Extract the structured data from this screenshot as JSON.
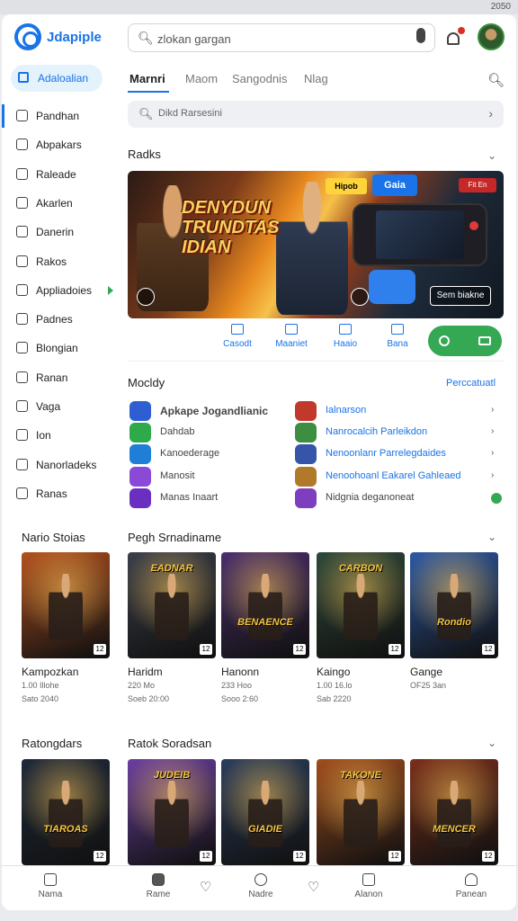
{
  "status": {
    "right": "2050"
  },
  "header": {
    "brand": "Jdapiple",
    "search_placeholder": "zlokan gargan",
    "accent": "#1a73e8"
  },
  "sidebar": {
    "active": "Adaloalian",
    "items": [
      {
        "label": "Pandhan",
        "icon": "home-icon"
      },
      {
        "label": "Abpakars",
        "icon": "list-icon"
      },
      {
        "label": "Raleade",
        "icon": "grid-icon"
      },
      {
        "label": "Akarlen",
        "icon": "file-icon"
      },
      {
        "label": "Danerin",
        "icon": "tag-icon"
      },
      {
        "label": "Rakos",
        "icon": "book-icon"
      },
      {
        "label": "Appliadoies",
        "icon": "user-icon"
      },
      {
        "label": "Padnes",
        "icon": "smile-icon"
      },
      {
        "label": "Blongian",
        "icon": "doc-icon"
      },
      {
        "label": "Ranan",
        "icon": "box-icon"
      },
      {
        "label": "Vaga",
        "icon": "clock-icon"
      },
      {
        "label": "Ion",
        "icon": "calendar-icon"
      },
      {
        "label": "Nanorladeks",
        "icon": "tiles-icon"
      },
      {
        "label": "Ranas",
        "icon": "star-icon"
      }
    ]
  },
  "tabs": [
    "Marnri",
    "Maom",
    "Sangodnis",
    "Nlag"
  ],
  "filter": {
    "text": "Dikd Rarsesini"
  },
  "packs": {
    "title": "Radks"
  },
  "banner": {
    "title": "DENYDUN TRUNDTAS IDIAN",
    "tag_a": "Hipob",
    "tag_b": "Gaia",
    "tag_c": "Fit En",
    "button": "Sem biakne"
  },
  "actions": [
    {
      "label": "Casodt",
      "icon": "monitor-icon"
    },
    {
      "label": "Maaniet",
      "icon": "window-icon"
    },
    {
      "label": "Haaio",
      "icon": "image-icon"
    },
    {
      "label": "Bana",
      "icon": "text-icon"
    }
  ],
  "apps": {
    "title": "Mocldy",
    "link": "Perccatuatl",
    "left": [
      {
        "name": "Apkape Jogandlianic",
        "color": "#2d5fd3",
        "bold": true
      },
      {
        "name": "Dahdab",
        "color": "#2eaa4a",
        "bold": false
      },
      {
        "name": "Kanoederage",
        "color": "#1f7fd6",
        "bold": false
      },
      {
        "name": "Manosit",
        "color": "#8a49d6",
        "bold": false
      },
      {
        "name": "Manas Inaart",
        "color": "#6a2fc0",
        "bold": false
      }
    ],
    "right": [
      {
        "name": "Ialnarson",
        "color": "#c0392b",
        "link": true
      },
      {
        "name": "Nanrocalcih Parleikdon",
        "color": "#3e8e41",
        "link": true
      },
      {
        "name": "Nenoonlanr Parrelegdaides",
        "color": "#3556a8",
        "link": true
      },
      {
        "name": "Nenoohoanl Eakarel Gahleaed",
        "color": "#b07a2a",
        "link": true
      },
      {
        "name": "Nidgnia deganoneat",
        "color": "#7e3fbf",
        "link": false
      }
    ]
  },
  "rail1": {
    "title_left": "Nario Stoias",
    "title_right": "Pegh Srnadiname",
    "cards": [
      {
        "title": "",
        "name": "Kampozkan",
        "m1": "1.00 Illohe",
        "m2": "Sato 2040",
        "badge": "12",
        "bg": "#b2501e"
      },
      {
        "title": "EADNAR",
        "name": "Haridm",
        "m1": "220 Mo",
        "m2": "Soeb 20:00",
        "badge": "12",
        "bg": "#3b3f4a"
      },
      {
        "title": "BENAENCE",
        "name": "Hanonn",
        "m1": "233 Hoo",
        "m2": "Sooo 2:60",
        "badge": "12",
        "bg": "#4b2f6d"
      },
      {
        "title": "CARBON",
        "name": "Kaingo",
        "m1": "1.00 16.lo",
        "m2": "Sab 2220",
        "badge": "12",
        "bg": "#2f4a3a"
      },
      {
        "title": "Rondio",
        "name": "Gange",
        "m1": "OF25 3an",
        "m2": "",
        "badge": "12",
        "bg": "#2d5aa6"
      }
    ]
  },
  "rail2": {
    "title_left": "Ratongdars",
    "title_right": "Ratok Soradsan",
    "cards": [
      {
        "title": "TIAROAS",
        "bg": "#1f2a3a",
        "badge": "12"
      },
      {
        "title": "JUDEIB",
        "bg": "#6b3fa0",
        "badge": "12"
      },
      {
        "title": "GIADIE",
        "bg": "#2a3d5c",
        "badge": "12"
      },
      {
        "title": "TAKONE",
        "bg": "#a14d1c",
        "badge": "12"
      },
      {
        "title": "MENCER",
        "bg": "#7a2f1a",
        "badge": "12"
      }
    ]
  },
  "bottomnav": [
    {
      "label": "Nama",
      "icon": "home-icon"
    },
    {
      "label": "Rame",
      "icon": "game-icon"
    },
    {
      "label": "Nadre",
      "icon": "person-icon"
    },
    {
      "label": "Alanon",
      "icon": "library-icon"
    },
    {
      "label": "Panean",
      "icon": "account-icon"
    }
  ]
}
